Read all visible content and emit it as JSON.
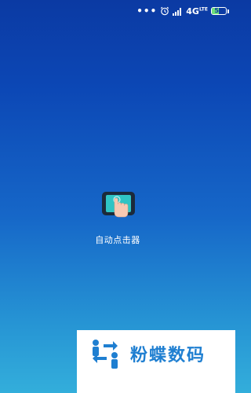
{
  "status_bar": {
    "dots": "•••",
    "network_type": "4G",
    "network_sub": "LTE",
    "battery_level": "52",
    "battery_fraction": 0.52,
    "icons": [
      "alarm-icon",
      "signal-icon",
      "battery-icon"
    ]
  },
  "app": {
    "name": "自动点击器",
    "icon": "touch-phone-icon"
  },
  "watermark": {
    "text": "粉蝶数码",
    "logo": "swap-arrows-logo"
  },
  "colors": {
    "background_top": "#0b3aa3",
    "background_bottom": "#33aedb",
    "icon_screen": "#2fc4c4",
    "watermark_text": "#1f7fd1"
  }
}
